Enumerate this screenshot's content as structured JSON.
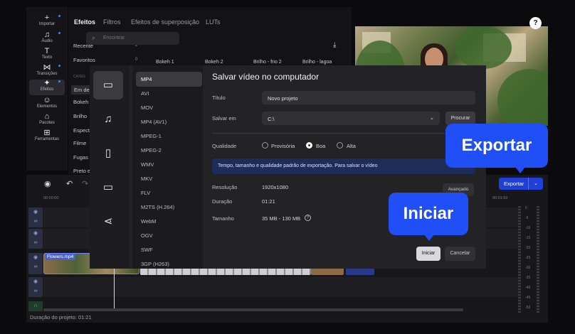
{
  "rail": {
    "items": [
      {
        "label": "Importar",
        "icon": "plus-icon"
      },
      {
        "label": "Áudio",
        "icon": "music-icon"
      },
      {
        "label": "Texto",
        "icon": "text-icon"
      },
      {
        "label": "Transições",
        "icon": "transition-icon"
      },
      {
        "label": "Efeitos",
        "icon": "sparkle-icon"
      },
      {
        "label": "Elementos",
        "icon": "smiley-icon"
      },
      {
        "label": "Pacotes",
        "icon": "bag-icon"
      },
      {
        "label": "Ferramentas",
        "icon": "grid-icon"
      }
    ]
  },
  "effects": {
    "tabs": [
      "Efeitos",
      "Filtros",
      "Efeitos de superposição",
      "LUTs"
    ],
    "categories": [
      {
        "label": "Recente",
        "count": "2"
      },
      {
        "label": "Favoritos",
        "count": "0"
      },
      {
        "label": "CATEG",
        "count": ""
      },
      {
        "label": "Em de",
        "count": ""
      },
      {
        "label": "Bokeh",
        "count": ""
      },
      {
        "label": "Brilho",
        "count": ""
      },
      {
        "label": "Espect",
        "count": ""
      },
      {
        "label": "Filme",
        "count": ""
      },
      {
        "label": "Fugas",
        "count": ""
      },
      {
        "label": "Preto e",
        "count": ""
      }
    ],
    "search_placeholder": "Encontrar",
    "thumbnails": [
      "Bokeh 1",
      "Bokeh 2",
      "Brilho - frio 2",
      "Brilho - lagoa"
    ]
  },
  "preview": {
    "help_label": "?"
  },
  "timeline": {
    "ruler": [
      "00:00:00",
      "00:01:50"
    ],
    "clip_name": "Flowers.mp4",
    "duration": "Duração do projeto: 01:21",
    "meter_labels": [
      "0",
      "-5",
      "-10",
      "-15",
      "-20",
      "-25",
      "-30",
      "-35",
      "-40",
      "-45",
      "-50"
    ],
    "export_label": "Exportar"
  },
  "dialog": {
    "title": "Salvar vídeo no computador",
    "formats": [
      "MP4",
      "AVI",
      "MOV",
      "MP4 (AV1)",
      "MPEG-1",
      "MPEG-2",
      "WMV",
      "MKV",
      "FLV",
      "M2TS (H.264)",
      "WebM",
      "OGV",
      "SWF",
      "3GP (H263)"
    ],
    "title_label": "Título",
    "title_value": "Novo projeto",
    "save_label": "Salvar em",
    "save_value": "C:\\",
    "browse_label": "Procurar",
    "quality_label": "Qualidade",
    "quality_options": [
      "Provisória",
      "Boa",
      "Alta"
    ],
    "quality_selected": "Boa",
    "info_text": "Tempo, tamanho e qualidade padrão de exportação. Para salvar o vídeo",
    "resolution_label": "Resolução",
    "resolution_value": "1920x1080",
    "advanced_label": "Avançado",
    "duration_label": "Duração",
    "duration_value": "01:21",
    "size_label": "Tamanho",
    "size_value": "35 MB - 130 MB",
    "start_label": "Iniciar",
    "cancel_label": "Cancelar"
  },
  "callouts": {
    "export": "Exportar",
    "start": "Iniciar"
  },
  "colors": {
    "accent": "#1f4ff5",
    "background": "#0b0b0d",
    "dialog": "#232326"
  }
}
